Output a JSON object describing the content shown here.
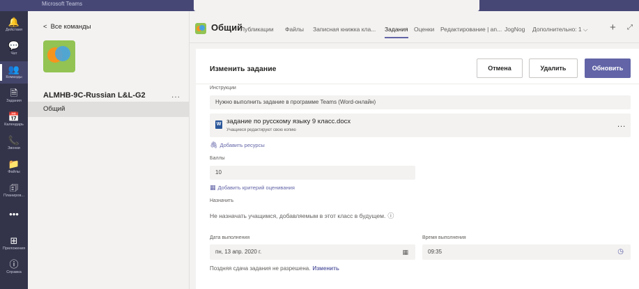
{
  "topbar": {
    "title": "Microsoft Teams"
  },
  "rail": [
    {
      "icon": "🔔",
      "label": "Действия"
    },
    {
      "icon": "💬",
      "label": "Чат"
    },
    {
      "icon": "👥",
      "label": "Команды"
    },
    {
      "icon": "🗎",
      "label": "Задания"
    },
    {
      "icon": "📅",
      "label": "Календарь"
    },
    {
      "icon": "📞",
      "label": "Звонки"
    },
    {
      "icon": "📁",
      "label": "Файлы"
    },
    {
      "icon": "🗊",
      "label": "Планиров..."
    },
    {
      "icon": "•••",
      "label": ""
    },
    {
      "icon": "⊞",
      "label": "Приложения"
    },
    {
      "icon": "ⓘ",
      "label": "Справка"
    }
  ],
  "team_panel": {
    "back_label": "Все команды",
    "team_name": "ALMHB-9C-Russian L&L-G2",
    "more": "...",
    "channel": "Общий"
  },
  "header": {
    "channel_title": "Общий",
    "tabs": [
      "Публикации",
      "Файлы",
      "Записная книжка кла...",
      "Задания",
      "Оценки",
      "Редактирование | an...",
      "JogNog"
    ],
    "active_tab": "Задания",
    "more_tabs": "Дополнительно: 1 ⌵",
    "add": "+",
    "expand": "⤢"
  },
  "card": {
    "title": "Изменить задание",
    "cancel": "Отмена",
    "delete": "Удалить",
    "update": "Обновить",
    "instructions_label": "Инструкции",
    "instructions_value": "Нужно выполнить задание в программе Teams (Word-онлайн)",
    "file_name": "задание по русскому языку 9 класс.docx",
    "file_sub": "Учащиеся редактируют свою копию",
    "file_more": "...",
    "add_resources": "Добавить ресурсы",
    "points_label": "Баллы",
    "points_value": "10",
    "add_rubric": "Добавить критерий оценивания",
    "assign_label": "Назначить",
    "assign_text": "Не назначать учащимся, добавляемым в этот класс в будущем.",
    "due_date_label": "Дата выполнения",
    "due_date_value": "пн, 13 апр. 2020 г.",
    "due_time_label": "Время выполнения",
    "due_time_value": "09:35",
    "late_text": "Поздняя сдача задания не разрешена.",
    "late_change": "Изменить"
  }
}
